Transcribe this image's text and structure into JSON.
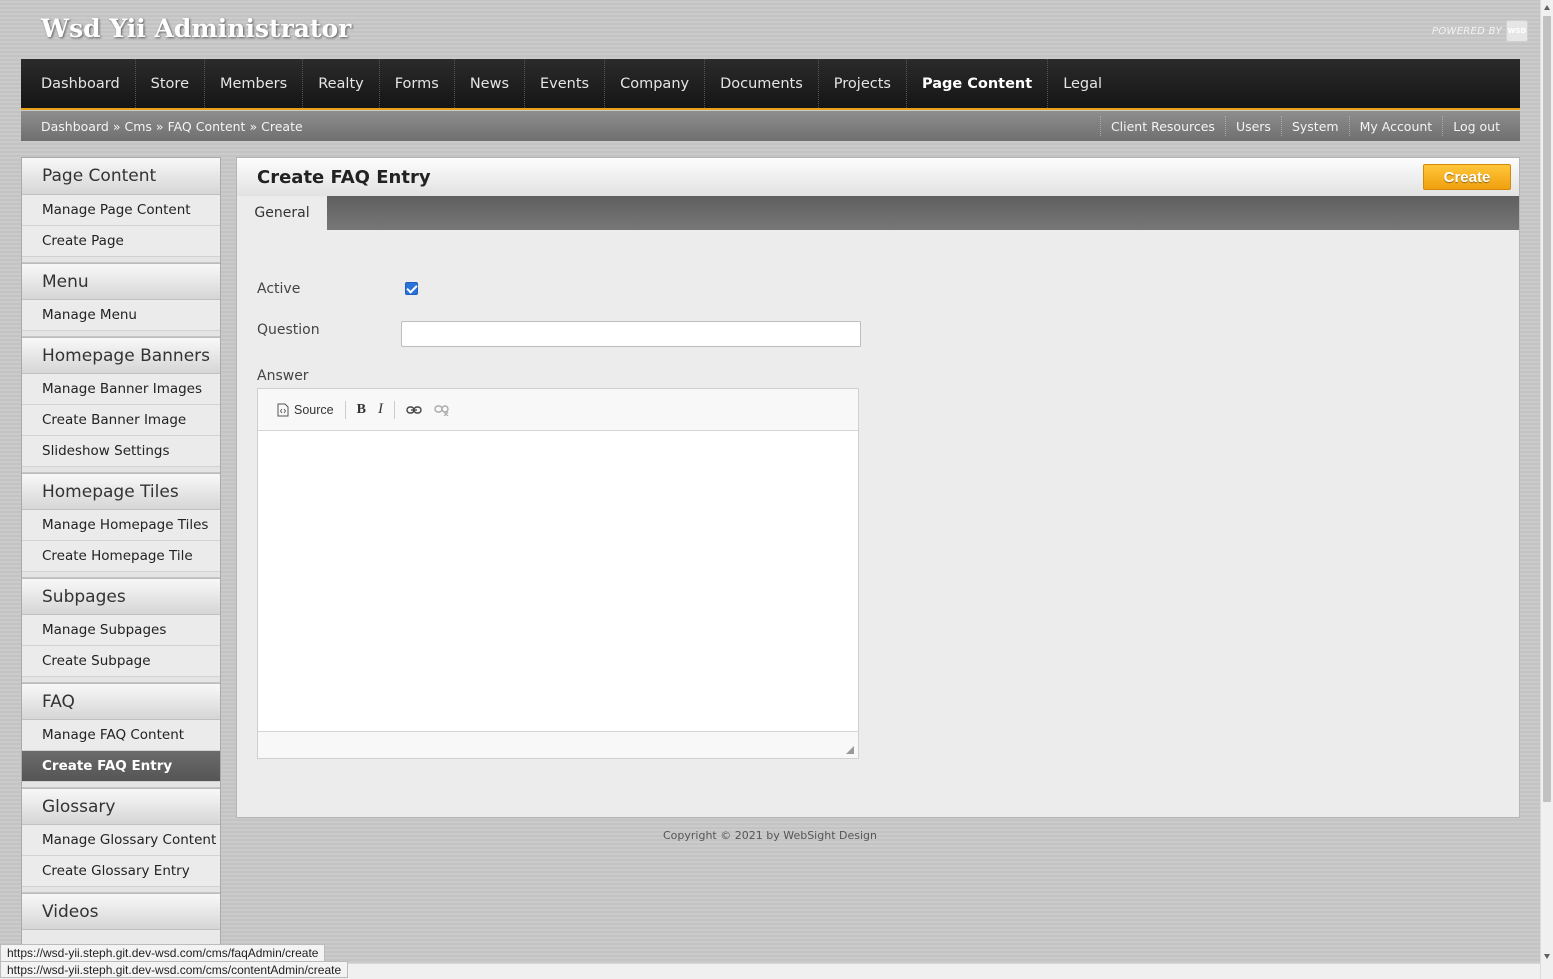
{
  "header": {
    "site_title": "Wsd Yii Administrator",
    "powered_by": "POWERED BY",
    "powered_logo": "WSD"
  },
  "main_nav": [
    {
      "label": "Dashboard",
      "active": false
    },
    {
      "label": "Store",
      "active": false
    },
    {
      "label": "Members",
      "active": false
    },
    {
      "label": "Realty",
      "active": false
    },
    {
      "label": "Forms",
      "active": false
    },
    {
      "label": "News",
      "active": false
    },
    {
      "label": "Events",
      "active": false
    },
    {
      "label": "Company",
      "active": false
    },
    {
      "label": "Documents",
      "active": false
    },
    {
      "label": "Projects",
      "active": false
    },
    {
      "label": "Page Content",
      "active": true
    },
    {
      "label": "Legal",
      "active": false
    }
  ],
  "breadcrumb": {
    "items": [
      "Dashboard",
      "Cms",
      "FAQ Content",
      "Create"
    ],
    "separator": "»"
  },
  "util_links": [
    "Client Resources",
    "Users",
    "System",
    "My Account",
    "Log out"
  ],
  "sidebar": {
    "sections": [
      {
        "title": "Page Content",
        "links": [
          "Manage Page Content",
          "Create Page"
        ]
      },
      {
        "title": "Menu",
        "links": [
          "Manage Menu"
        ]
      },
      {
        "title": "Homepage Banners",
        "links": [
          "Manage Banner Images",
          "Create Banner Image",
          "Slideshow Settings"
        ]
      },
      {
        "title": "Homepage Tiles",
        "links": [
          "Manage Homepage Tiles",
          "Create Homepage Tile"
        ]
      },
      {
        "title": "Subpages",
        "links": [
          "Manage Subpages",
          "Create Subpage"
        ]
      },
      {
        "title": "FAQ",
        "links": [
          "Manage FAQ Content",
          "Create FAQ Entry"
        ]
      },
      {
        "title": "Glossary",
        "links": [
          "Manage Glossary Content",
          "Create Glossary Entry"
        ]
      },
      {
        "title": "Videos",
        "links": []
      }
    ],
    "active_link": "Create FAQ Entry"
  },
  "content": {
    "title": "Create FAQ Entry",
    "create_button": "Create",
    "tab": "General",
    "active_label": "Active",
    "active_checked": true,
    "question_label": "Question",
    "question_value": "",
    "answer_label": "Answer",
    "editor_toolbar": {
      "source": "Source",
      "bold": "B",
      "italic": "I"
    }
  },
  "footer": "Copyright © 2021 by WebSight Design",
  "status_bar": {
    "url_hover": "https://wsd-yii.steph.git.dev-wsd.com/cms/faqAdmin/create",
    "url_under": "https://wsd-yii.steph.git.dev-wsd.com/cms/contentAdmin/create"
  },
  "colors": {
    "accent": "#e8a21a",
    "nav_bg": "#1f1f1f",
    "create_button": "#f5b21f",
    "checkbox": "#2a73d9"
  }
}
